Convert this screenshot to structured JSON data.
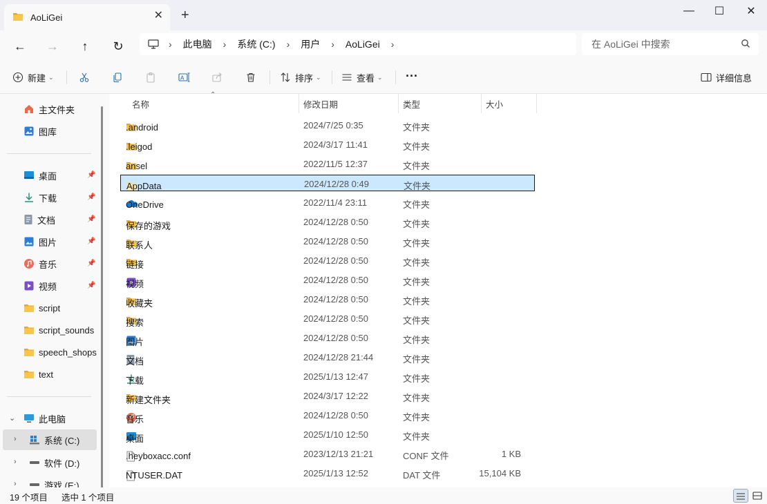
{
  "window": {
    "tab_title": "AoLiGei",
    "tab_close": "✕",
    "new_tab": "+",
    "minimize": "—",
    "maximize": "☐",
    "close": "✕"
  },
  "nav": {
    "back": "←",
    "forward": "→",
    "up": "↑",
    "refresh": "↻"
  },
  "breadcrumb": [
    "此电脑",
    "系统 (C:)",
    "用户",
    "AoLiGei"
  ],
  "search": {
    "placeholder": "在 AoLiGei 中搜索"
  },
  "toolbar": {
    "new_label": "新建",
    "sort_label": "排序",
    "view_label": "查看",
    "more_label": "···",
    "details_label": "详细信息"
  },
  "sidebar": {
    "home": "主文件夹",
    "gallery": "图库",
    "quick": [
      {
        "label": "桌面",
        "icon": "desktop-icon"
      },
      {
        "label": "下载",
        "icon": "download-icon"
      },
      {
        "label": "文档",
        "icon": "document-icon"
      },
      {
        "label": "图片",
        "icon": "pictures-icon"
      },
      {
        "label": "音乐",
        "icon": "music-icon"
      },
      {
        "label": "视频",
        "icon": "video-icon"
      }
    ],
    "folders": [
      "script",
      "script_sounds",
      "speech_shops",
      "text"
    ],
    "this_pc": "此电脑",
    "drives": [
      "系统 (C:)",
      "软件 (D:)",
      "游戏 (E:)"
    ]
  },
  "columns": {
    "name": "名称",
    "date": "修改日期",
    "type": "类型",
    "size": "大小"
  },
  "files": [
    {
      "name": ".android",
      "date": "2024/7/25 0:35",
      "type": "文件夹",
      "size": "",
      "icon": "folder-icon"
    },
    {
      "name": ".leigod",
      "date": "2024/3/17 11:41",
      "type": "文件夹",
      "size": "",
      "icon": "folder-icon"
    },
    {
      "name": "ansel",
      "date": "2022/11/5 12:37",
      "type": "文件夹",
      "size": "",
      "icon": "folder-icon"
    },
    {
      "name": "AppData",
      "date": "2024/12/28 0:49",
      "type": "文件夹",
      "size": "",
      "icon": "folder-hidden-icon"
    },
    {
      "name": "OneDrive",
      "date": "2022/11/4 23:11",
      "type": "文件夹",
      "size": "",
      "icon": "onedrive-icon"
    },
    {
      "name": "保存的游戏",
      "date": "2024/12/28 0:50",
      "type": "文件夹",
      "size": "",
      "icon": "folder-icon"
    },
    {
      "name": "联系人",
      "date": "2024/12/28 0:50",
      "type": "文件夹",
      "size": "",
      "icon": "folder-icon"
    },
    {
      "name": "链接",
      "date": "2024/12/28 0:50",
      "type": "文件夹",
      "size": "",
      "icon": "folder-icon"
    },
    {
      "name": "视频",
      "date": "2024/12/28 0:50",
      "type": "文件夹",
      "size": "",
      "icon": "video-icon"
    },
    {
      "name": "收藏夹",
      "date": "2024/12/28 0:50",
      "type": "文件夹",
      "size": "",
      "icon": "folder-icon"
    },
    {
      "name": "搜索",
      "date": "2024/12/28 0:50",
      "type": "文件夹",
      "size": "",
      "icon": "folder-icon"
    },
    {
      "name": "图片",
      "date": "2024/12/28 0:50",
      "type": "文件夹",
      "size": "",
      "icon": "pictures-icon"
    },
    {
      "name": "文档",
      "date": "2024/12/28 21:44",
      "type": "文件夹",
      "size": "",
      "icon": "document-icon"
    },
    {
      "name": "下载",
      "date": "2025/1/13 12:47",
      "type": "文件夹",
      "size": "",
      "icon": "download-icon"
    },
    {
      "name": "新建文件夹",
      "date": "2024/3/17 12:22",
      "type": "文件夹",
      "size": "",
      "icon": "folder-icon"
    },
    {
      "name": "音乐",
      "date": "2024/12/28 0:50",
      "type": "文件夹",
      "size": "",
      "icon": "music-icon"
    },
    {
      "name": "桌面",
      "date": "2025/1/10 12:50",
      "type": "文件夹",
      "size": "",
      "icon": "desktop-icon"
    },
    {
      "name": ".heyboxacc.conf",
      "date": "2023/12/13 21:21",
      "type": "CONF 文件",
      "size": "1 KB",
      "icon": "file-icon"
    },
    {
      "name": "NTUSER.DAT",
      "date": "2025/1/13 12:52",
      "type": "DAT 文件",
      "size": "15,104 KB",
      "icon": "file-icon"
    }
  ],
  "selected_index": 3,
  "status": {
    "count": "19 个项目",
    "selected": "选中 1 个项目"
  },
  "colors": {
    "accent": "#0067c0",
    "selection": "#cce8ff",
    "folder": "#f8c64a"
  }
}
